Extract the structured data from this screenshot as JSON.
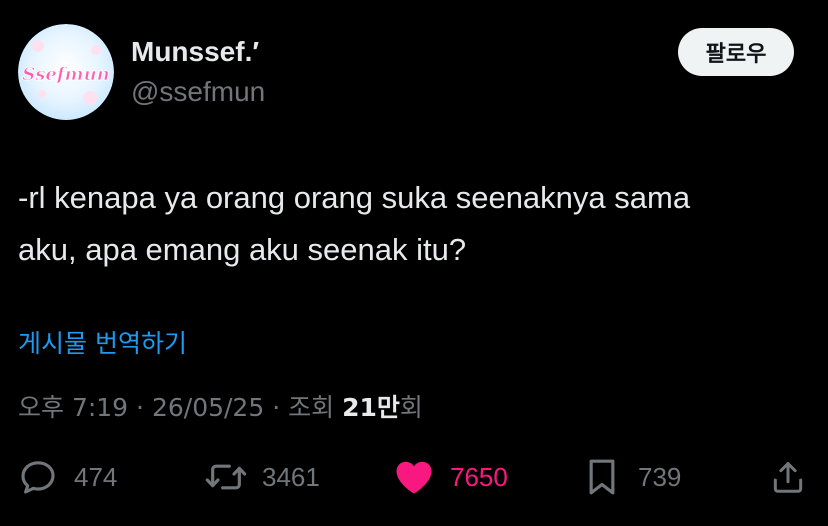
{
  "author": {
    "display_name": "Munssef.′",
    "handle": "@ssefmun",
    "avatar_text": "Ssefmun"
  },
  "follow_button": {
    "label": "팔로우"
  },
  "post": {
    "text": "-rl kenapa ya orang orang suka seenaknya sama\naku, apa emang aku seenak itu?",
    "translate_label": "게시물 번역하기"
  },
  "meta": {
    "time": "오후 7:19",
    "date": "26/05/25",
    "separator": "·",
    "views_prefix": "조회",
    "views_count": "21만",
    "views_suffix": "회"
  },
  "actions": {
    "replies": {
      "icon": "reply-icon",
      "count": "474"
    },
    "reposts": {
      "icon": "repost-icon",
      "count": "3461"
    },
    "likes": {
      "icon": "heart-filled-icon",
      "count": "7650",
      "liked": true
    },
    "bookmarks": {
      "icon": "bookmark-icon",
      "count": "739"
    },
    "share": {
      "icon": "share-icon"
    }
  },
  "colors": {
    "background": "#000000",
    "text_primary": "#e7e9ea",
    "text_secondary": "#71767b",
    "link": "#1d9bf0",
    "like": "#f91880",
    "follow_bg": "#eff3f4"
  }
}
